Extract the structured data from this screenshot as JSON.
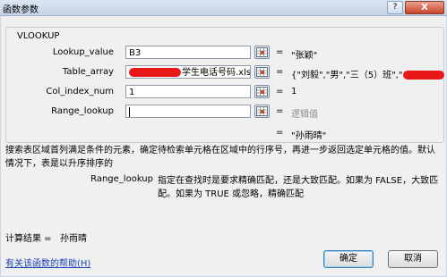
{
  "window": {
    "title": "函数参数",
    "help_button": "?",
    "close_button": "X"
  },
  "function_name": "VLOOKUP",
  "arguments": [
    {
      "label": "Lookup_value",
      "input": "B3",
      "equals": "=",
      "result": "\"张颖\""
    },
    {
      "label": "Table_array",
      "input": "学生电话号码.xls",
      "equals": "=",
      "result": "{\"刘毅\",\"男\",\"三（5）班\",\""
    },
    {
      "label": "Col_index_num",
      "input": "1",
      "equals": "=",
      "result": "1"
    },
    {
      "label": "Range_lookup",
      "input": "",
      "equals": "=",
      "result": "逻辑值"
    }
  ],
  "overall_result": {
    "equals": "=",
    "value": "\"孙雨晴\""
  },
  "description": "搜索表区域首列满足条件的元素，确定待检索单元格在区域中的行序号，再进一步返回选定单元格的值。默认情况下，表是以升序排序的",
  "argument_help": {
    "name": "Range_lookup",
    "text": "指定在查找时是要求精确匹配，还是大致匹配。如果为 FALSE，大致匹配。如果为 TRUE 或忽略，精确匹配"
  },
  "calc_result": {
    "label": "计算结果 =",
    "value": "孙雨晴"
  },
  "help_link": "有关该函数的帮助(H)",
  "buttons": {
    "ok": "确定",
    "cancel": "取消"
  },
  "colors": {
    "redaction": "#e81818",
    "link": "#1a3fb5"
  },
  "icons": [
    "range-select-icon"
  ]
}
